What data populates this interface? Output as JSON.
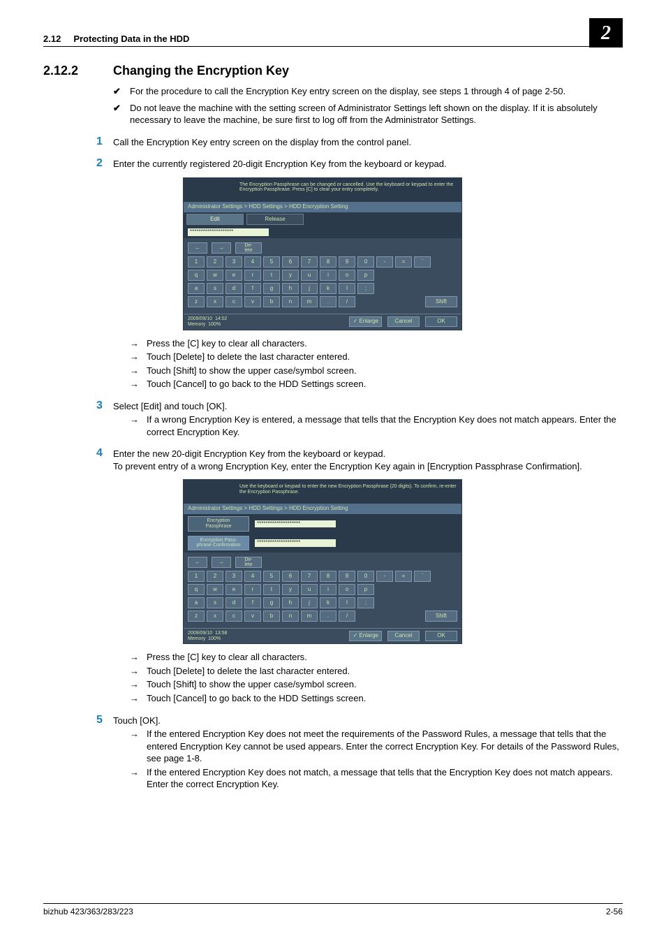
{
  "header": {
    "section_number": "2.12",
    "section_title": "Protecting Data in the HDD",
    "chapter_badge": "2"
  },
  "h2": {
    "number": "2.12.2",
    "title": "Changing the Encryption Key"
  },
  "intro_checks": [
    "For the procedure to call the Encryption Key entry screen on the display, see steps 1 through 4 of page 2-50.",
    "Do not leave the machine with the setting screen of Administrator Settings left shown on the display. If it is absolutely necessary to leave the machine, be sure first to log off from the Administrator Settings."
  ],
  "steps": {
    "s1": "Call the Encryption Key entry screen on the display from the control panel.",
    "s2": "Enter the currently registered 20-digit Encryption Key from the keyboard or keypad.",
    "s3": "Select [Edit] and touch [OK].",
    "s4a": "Enter the new 20-digit Encryption Key from the keyboard or keypad.",
    "s4b": "To prevent entry of a wrong Encryption Key, enter the Encryption Key again in [Encryption Passphrase Confirmation].",
    "s5": "Touch [OK]."
  },
  "after2": [
    "Press the [C] key to clear all characters.",
    "Touch [Delete] to delete the last character entered.",
    "Touch [Shift] to show the upper case/symbol screen.",
    "Touch [Cancel] to go back to the HDD Settings screen."
  ],
  "after3": [
    "If a wrong Encryption Key is entered, a message that tells that the Encryption Key does not match appears. Enter the correct Encryption Key."
  ],
  "after4": [
    "Press the [C] key to clear all characters.",
    "Touch [Delete] to delete the last character entered.",
    "Touch [Shift] to show the upper case/symbol screen.",
    "Touch [Cancel] to go back to the HDD Settings screen."
  ],
  "after5": [
    "If the entered Encryption Key does not meet the requirements of the Password Rules, a message that tells that the entered Encryption Key cannot be used appears. Enter the correct Encryption Key. For details of the Password Rules, see page 1-8.",
    "If the entered Encryption Key does not match, a message that tells that the Encryption Key does not match appears. Enter the correct Encryption Key."
  ],
  "panel1": {
    "top_msg": "The Encryption Passphrase can be changed or cancelled. Use the keyboard or keypad to enter the Encryption Passphrase. Press [C] to clear your entry completely.",
    "crumb": "Administrator Settings > HDD Settings > HDD Encryption Setting",
    "tab_edit": "Edit",
    "tab_release": "Release",
    "masked": "********************",
    "delete": "De-\nlete",
    "row1": [
      "1",
      "2",
      "3",
      "4",
      "5",
      "6",
      "7",
      "8",
      "9",
      "0",
      "-",
      "=",
      "`"
    ],
    "row2": [
      "q",
      "w",
      "e",
      "r",
      "t",
      "y",
      "u",
      "i",
      "o",
      "p"
    ],
    "row3": [
      "a",
      "s",
      "d",
      "f",
      "g",
      "h",
      "j",
      "k",
      "l",
      ";"
    ],
    "row4": [
      "z",
      "x",
      "c",
      "v",
      "b",
      "n",
      "m",
      ".",
      "/"
    ],
    "shift": "Shift",
    "date": "2009/09/10",
    "time": "14:02",
    "mem_label": "Memory",
    "mem_val": "100%",
    "enlarge": "Enlarge",
    "cancel": "Cancel",
    "ok": "OK"
  },
  "panel2": {
    "top_msg": "Use the keyboard or keypad to enter the new Encryption Passphrase (20 digits). To confirm, re-enter the Encryption Passphrase.",
    "crumb": "Administrator Settings > HDD Settings > HDD Encryption Setting",
    "lbl1": "Encryption\nPassphrase",
    "lbl2": "Encryption Pass-\nphrase Confirmation",
    "masked1": "********************",
    "masked2": "********************",
    "delete": "De-\nlete",
    "row1": [
      "1",
      "2",
      "3",
      "4",
      "5",
      "6",
      "7",
      "8",
      "9",
      "0",
      "-",
      "=",
      "`"
    ],
    "row2": [
      "q",
      "w",
      "e",
      "r",
      "t",
      "y",
      "u",
      "i",
      "o",
      "p"
    ],
    "row3": [
      "a",
      "s",
      "d",
      "f",
      "g",
      "h",
      "j",
      "k",
      "l",
      ";"
    ],
    "row4": [
      "z",
      "x",
      "c",
      "v",
      "b",
      "n",
      "m",
      ".",
      "/"
    ],
    "shift": "Shift",
    "date": "2009/09/10",
    "time": "13:58",
    "mem_label": "Memory",
    "mem_val": "100%",
    "enlarge": "Enlarge",
    "cancel": "Cancel",
    "ok": "OK"
  },
  "footer": {
    "left": "bizhub 423/363/283/223",
    "right": "2-56"
  }
}
